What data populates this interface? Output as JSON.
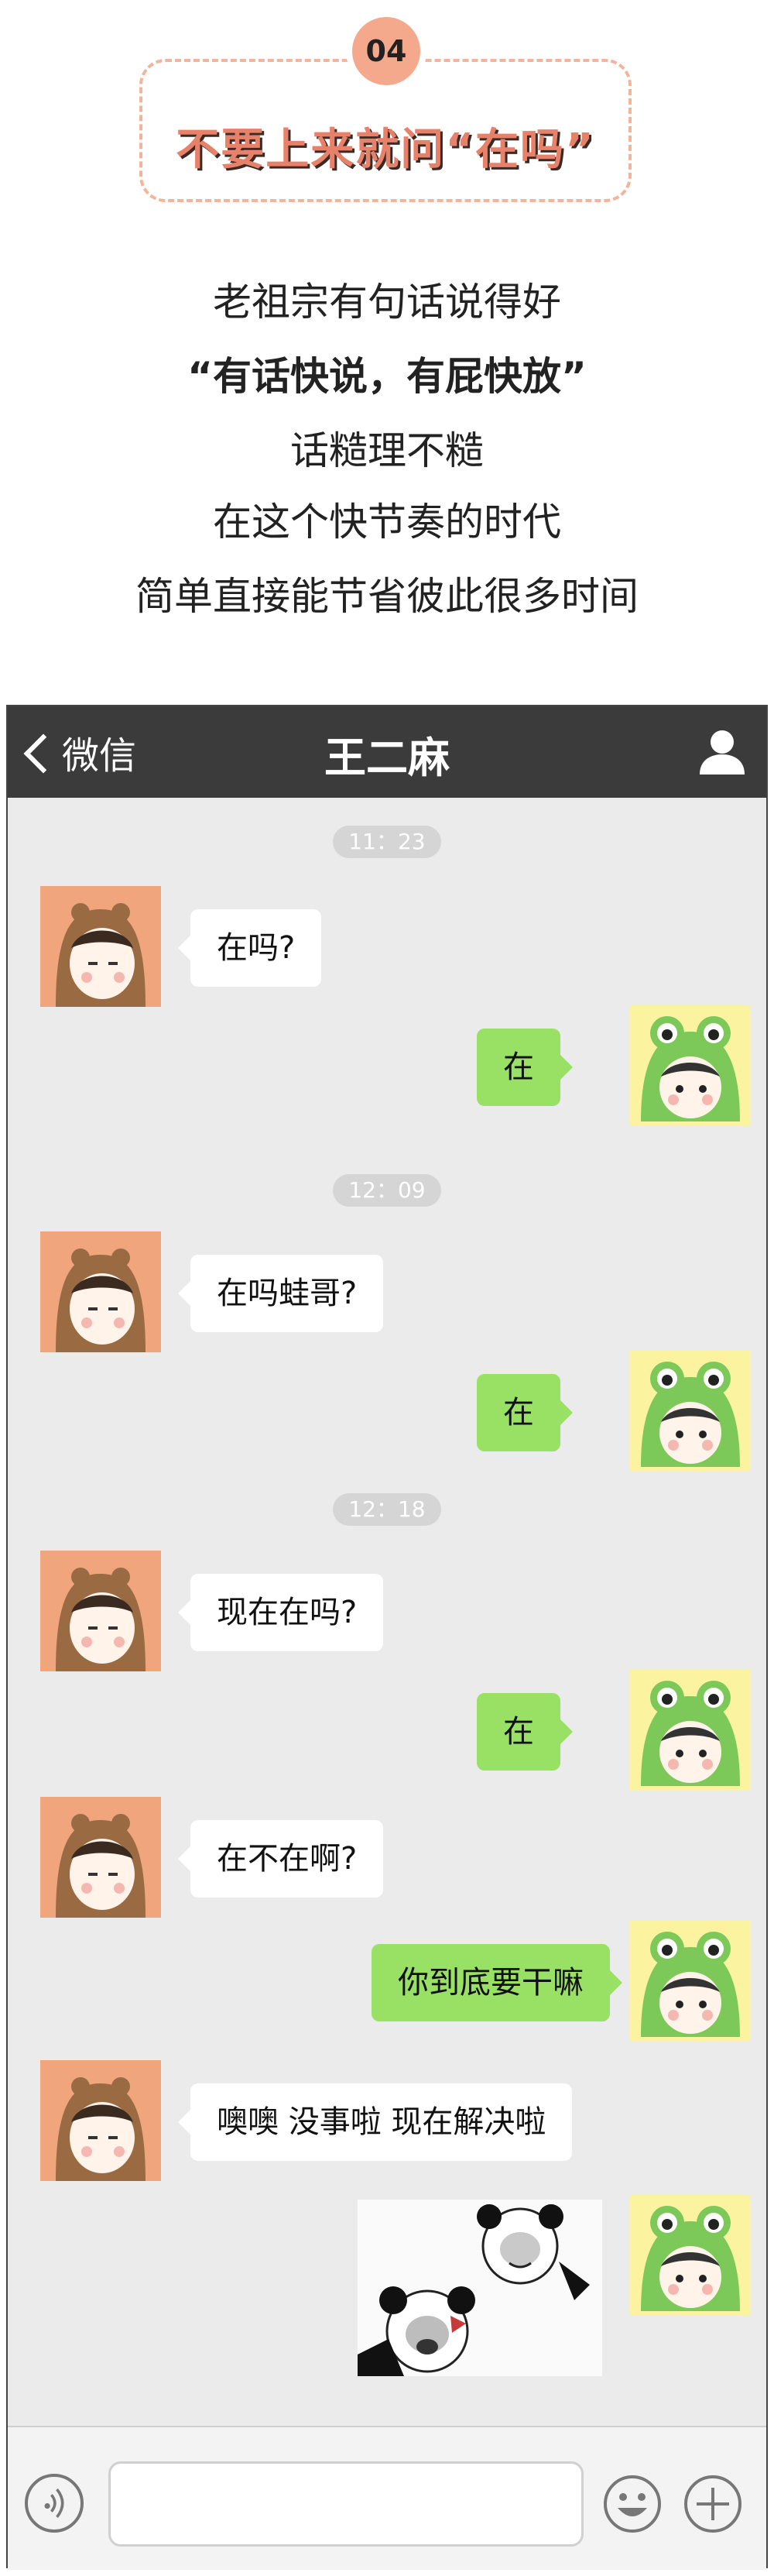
{
  "header": {
    "number": "04",
    "title": "不要上来就问“在吗”"
  },
  "intro_lines": [
    {
      "text": "老祖宗有句话说得好",
      "bold": false
    },
    {
      "text": "“有话快说，有屁快放”",
      "bold": true
    },
    {
      "text": "话糙理不糙",
      "bold": false
    },
    {
      "text": "在这个快节奏的时代",
      "bold": false
    },
    {
      "text": "简单直接能节省彼此很多时间",
      "bold": false
    }
  ],
  "chat": {
    "back_label": "微信",
    "contact_name": "王二麻",
    "timestamps": [
      "11：23",
      "12：09",
      "12：18"
    ],
    "messages": [
      {
        "side": "left",
        "text": "在吗?"
      },
      {
        "side": "right",
        "text": "在"
      },
      {
        "side": "left",
        "text": "在吗蛙哥?"
      },
      {
        "side": "right",
        "text": "在"
      },
      {
        "side": "left",
        "text": "现在在吗?"
      },
      {
        "side": "right",
        "text": "在"
      },
      {
        "side": "left",
        "text": "在不在啊?"
      },
      {
        "side": "right",
        "text": "你到底要干嘛"
      },
      {
        "side": "left",
        "text": "噢噢 没事啦 现在解决啦"
      },
      {
        "side": "right",
        "type": "sticker",
        "sticker": "panda-meme-sticker"
      }
    ]
  },
  "icons": {
    "back": "chevron-left-icon",
    "user": "user-icon",
    "voice": "voice-icon",
    "emoji": "emoji-icon",
    "plus": "plus-icon"
  },
  "colors": {
    "accent": "#e8816a",
    "bubble_right": "#98e165",
    "topbar": "#3b3b3b"
  }
}
